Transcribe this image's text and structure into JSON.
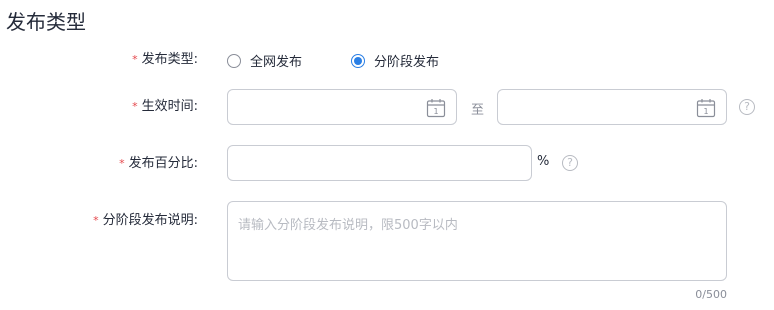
{
  "page": {
    "title": "发布类型"
  },
  "form": {
    "release_type": {
      "label": "发布类型:",
      "required_mark": "*",
      "options": [
        {
          "label": "全网发布",
          "selected": false
        },
        {
          "label": "分阶段发布",
          "selected": true
        }
      ]
    },
    "effective_time": {
      "label": "生效时间:",
      "required_mark": "*",
      "separator": "至",
      "start_value": "",
      "end_value": "",
      "calendar_day": "1"
    },
    "release_percent": {
      "label": "发布百分比:",
      "required_mark": "*",
      "value": "",
      "unit": "%"
    },
    "phased_description": {
      "label": "分阶段发布说明:",
      "required_mark": "*",
      "placeholder": "请输入分阶段发布说明，限500字以内",
      "value": "",
      "counter": "0/500"
    },
    "help_glyph": "?"
  },
  "colors": {
    "accent": "#2a7fe5",
    "required": "#e5474b",
    "border": "#c9ccd3"
  }
}
